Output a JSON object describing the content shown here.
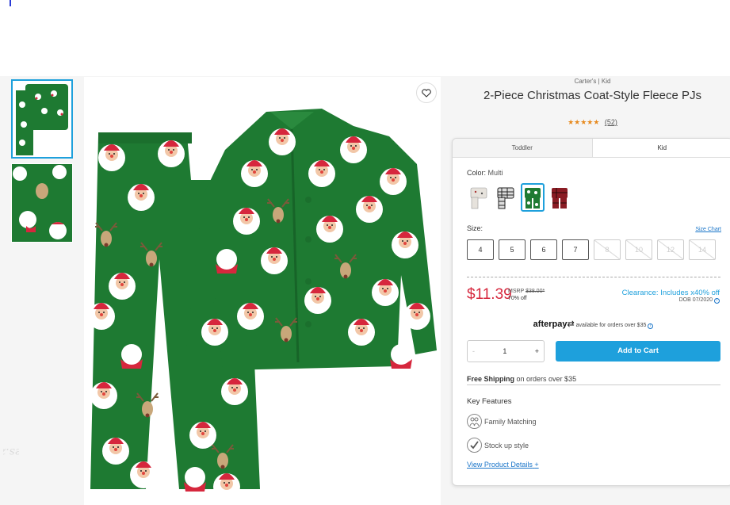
{
  "product": {
    "brand": "Carter's | Kid",
    "title": "2-Piece Christmas Coat-Style Fleece PJs",
    "stars": "★★★★★",
    "review_count": "(52)"
  },
  "tabs": [
    {
      "label": "Toddler"
    },
    {
      "label": "Kid"
    }
  ],
  "color": {
    "label": "Color:",
    "value": "Multi"
  },
  "size": {
    "label": "Size:",
    "chart_link": "Size Chart",
    "options": [
      "4",
      "5",
      "6",
      "7",
      "8",
      "10",
      "12",
      "14"
    ]
  },
  "pricing": {
    "price": "$11.39",
    "msrp_label": "MSRP",
    "msrp_value": "$38.00*",
    "percent_off": "70% off",
    "clearance": "Clearance: Includes x40% off",
    "dob": "DOB 07/2020"
  },
  "afterpay": {
    "brand": "afterpay",
    "text": "available for orders over $35"
  },
  "quantity": {
    "minus": "-",
    "value": "1",
    "plus": "+"
  },
  "add_to_cart": "Add to Cart",
  "shipping": {
    "bold": "Free Shipping",
    "text": "on orders over $35"
  },
  "features": {
    "title": "Key Features",
    "items": [
      "Family Matching",
      "Stock up style"
    ]
  },
  "details_link": "View Product Details",
  "details_plus": "+",
  "watermark": "Ludies.zp.ua",
  "colors": {
    "accent": "#1ea0dc",
    "sale": "#d6273d",
    "pajama_green": "#1e7a32",
    "star": "#e78a1f"
  }
}
